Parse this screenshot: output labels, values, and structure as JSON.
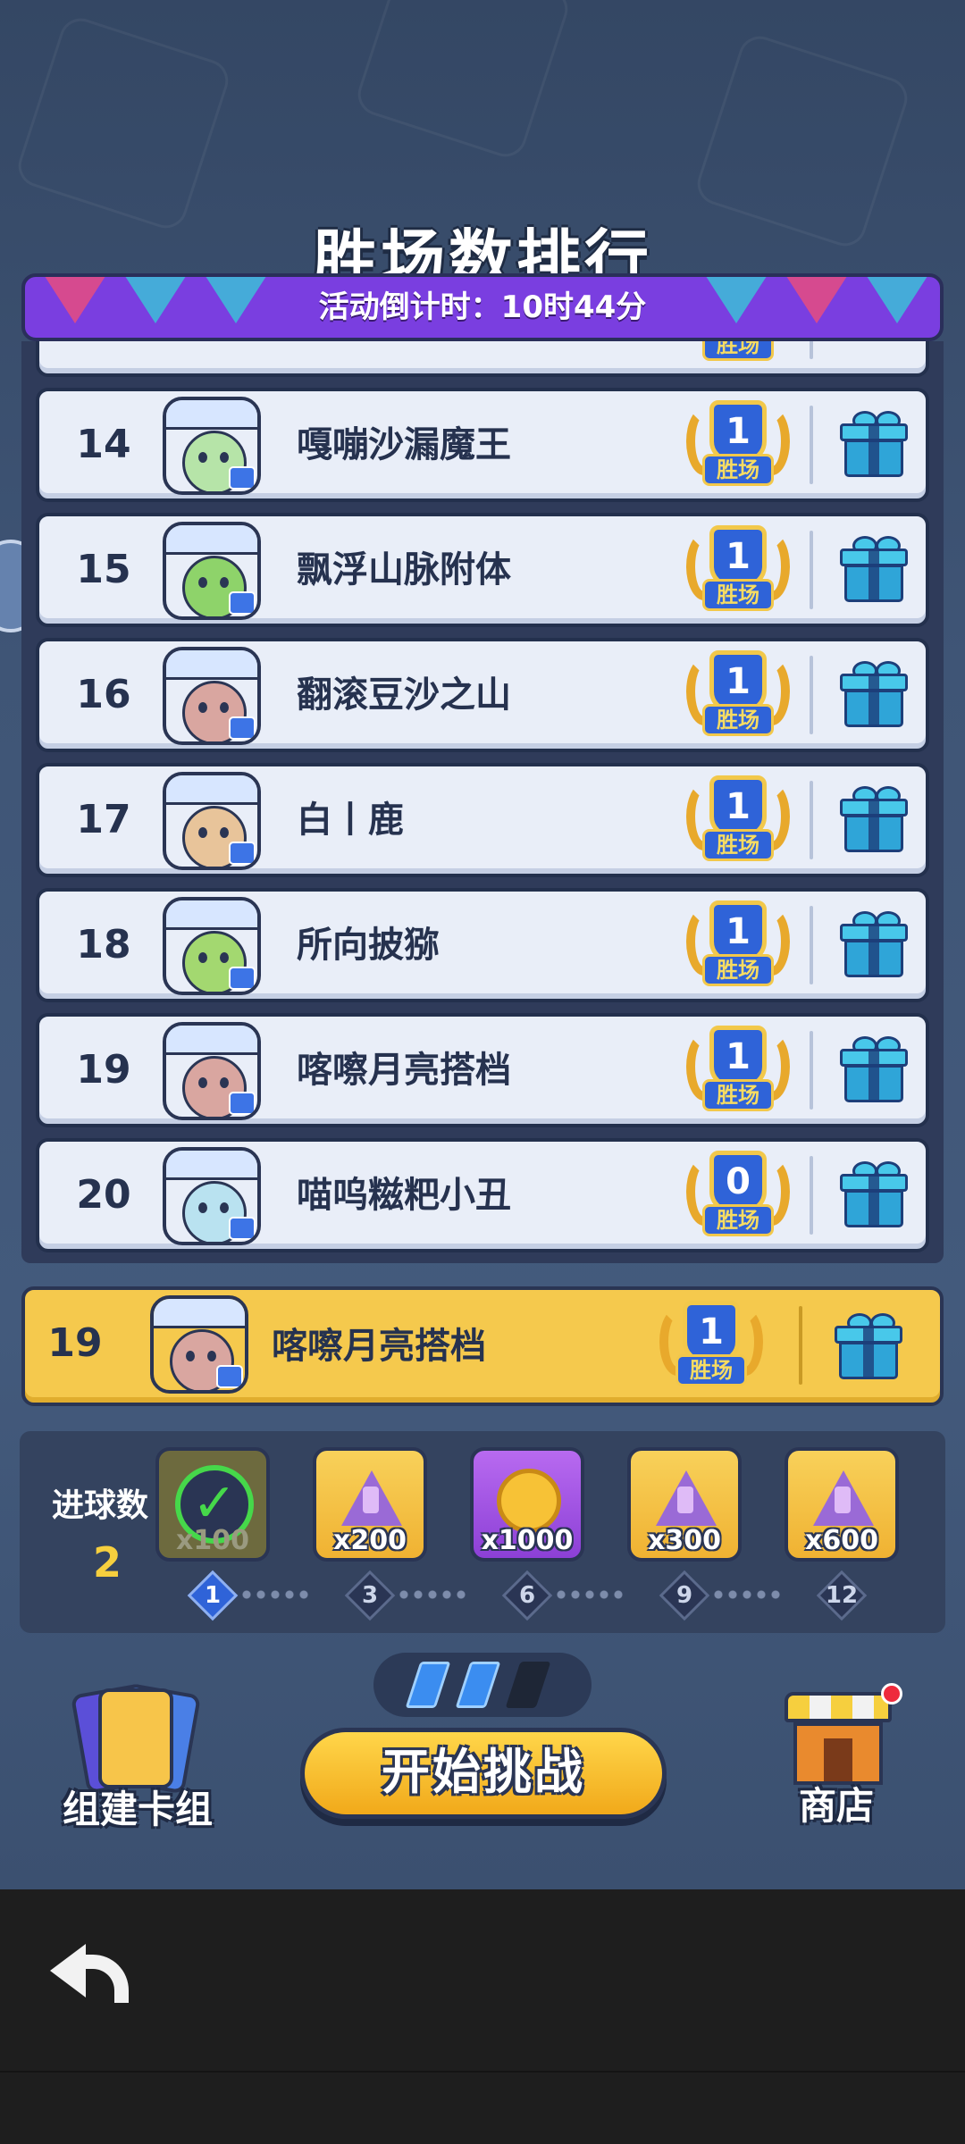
{
  "page_title": "胜场数排行",
  "countdown": "活动倒计时：10时44分",
  "leaderboard": [
    {
      "rank": "14",
      "name": "嘎嘣沙漏魔王",
      "wins": "1",
      "wins_label": "胜场",
      "avatar_color": "#b6e4a8"
    },
    {
      "rank": "15",
      "name": "飘浮山脉附体",
      "wins": "1",
      "wins_label": "胜场",
      "avatar_color": "#8ed36a"
    },
    {
      "rank": "16",
      "name": "翻滚豆沙之山",
      "wins": "1",
      "wins_label": "胜场",
      "avatar_color": "#d9a6a0"
    },
    {
      "rank": "17",
      "name": "白丨鹿",
      "wins": "1",
      "wins_label": "胜场",
      "avatar_color": "#e8c49a"
    },
    {
      "rank": "18",
      "name": "所向披猕",
      "wins": "1",
      "wins_label": "胜场",
      "avatar_color": "#a3d870"
    },
    {
      "rank": "19",
      "name": "喀嚓月亮搭档",
      "wins": "1",
      "wins_label": "胜场",
      "avatar_color": "#d9a6a0"
    },
    {
      "rank": "20",
      "name": "喵呜糍粑小丑",
      "wins": "0",
      "wins_label": "胜场",
      "avatar_color": "#b9e2f0"
    }
  ],
  "partial_row": {
    "wins_label": "胜场"
  },
  "my_rank": {
    "rank": "19",
    "name": "喀嚓月亮搭档",
    "wins": "1",
    "wins_label": "胜场",
    "avatar_color": "#d9a6a0"
  },
  "goals": {
    "label": "进球数",
    "value": "2",
    "rewards": [
      {
        "qty": "x100",
        "icon": "check-icon",
        "claimed": true,
        "milestone": "1"
      },
      {
        "qty": "x200",
        "icon": "gem-icon",
        "claimed": false,
        "milestone": "3"
      },
      {
        "qty": "x1000",
        "icon": "coin-icon",
        "claimed": false,
        "milestone": "6"
      },
      {
        "qty": "x300",
        "icon": "gem-icon",
        "claimed": false,
        "milestone": "9"
      },
      {
        "qty": "x600",
        "icon": "gem-icon",
        "claimed": false,
        "milestone": "12"
      }
    ]
  },
  "energy": {
    "filled": 2,
    "total": 3
  },
  "buttons": {
    "build_deck": "组建卡组",
    "start_challenge": "开始挑战",
    "shop": "商店"
  },
  "colors": {
    "accent_purple": "#7a3ee0",
    "highlight_yellow": "#f5c94d",
    "win_blue": "#2f63d8"
  }
}
